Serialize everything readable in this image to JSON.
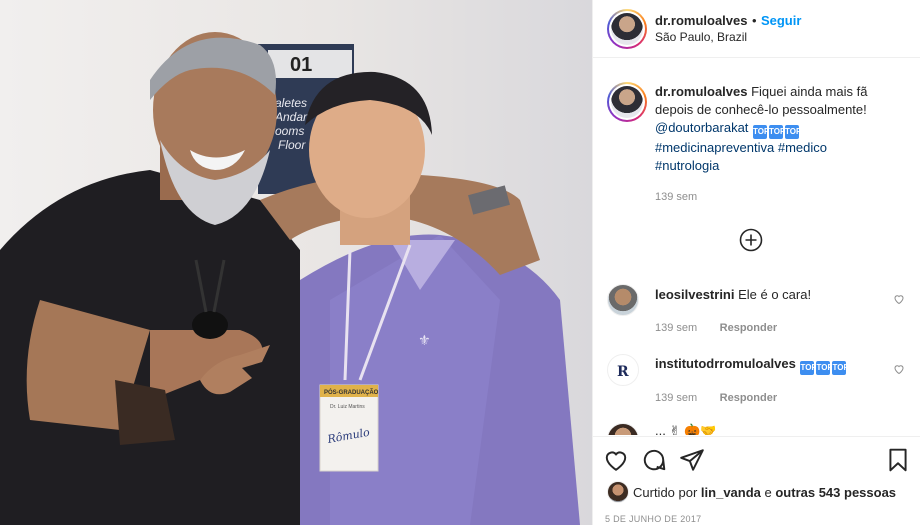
{
  "post": {
    "author": "dr.romuloalves",
    "separator": "•",
    "follow_label": "Seguir",
    "location": "São Paulo, Brazil"
  },
  "photo": {
    "sign_number": "01",
    "sign_line1": "aletes",
    "sign_line2": "Andar",
    "sign_line3": "ooms",
    "sign_line4": "Floor",
    "badge_title": "PÓS-GRADUAÇÃO",
    "badge_sub": "Dr. Luiz Martins",
    "badge_handwriting": "Rômulo"
  },
  "caption": {
    "author": "dr.romuloalves",
    "text": " Fiquei ainda mais fã depois de conhecê-lo pessoalmente! ",
    "mention": "@doutorbarakat",
    "hashtags": [
      "#medicinapreventiva",
      "#medico",
      "#nutrologia"
    ],
    "time": "139 sem",
    "badge_glyph": "TOP"
  },
  "comments": [
    {
      "user": "leosilvestrini",
      "text": " Ele é o cara!",
      "time": "139 sem",
      "reply_label": "Responder"
    },
    {
      "user": "institutodrromuloalves",
      "text": "",
      "time": "139 sem",
      "reply_label": "Responder"
    }
  ],
  "partial_comment": {
    "text": "...",
    "emoji": "✌ 🎃🤝"
  },
  "actions": {
    "like_icon": "heart-icon",
    "comment_icon": "comment-icon",
    "share_icon": "share-icon",
    "save_icon": "bookmark-icon"
  },
  "likes": {
    "prefix": "Curtido por ",
    "user": "lin_vanda",
    "middle": " e ",
    "others": "outras 543 pessoas"
  },
  "date": "5 DE JUNHO DE 2017",
  "colors": {
    "link": "#0095f6",
    "tag": "#00376b",
    "muted": "#8e8e8e",
    "badge": "#3d8ef0"
  }
}
